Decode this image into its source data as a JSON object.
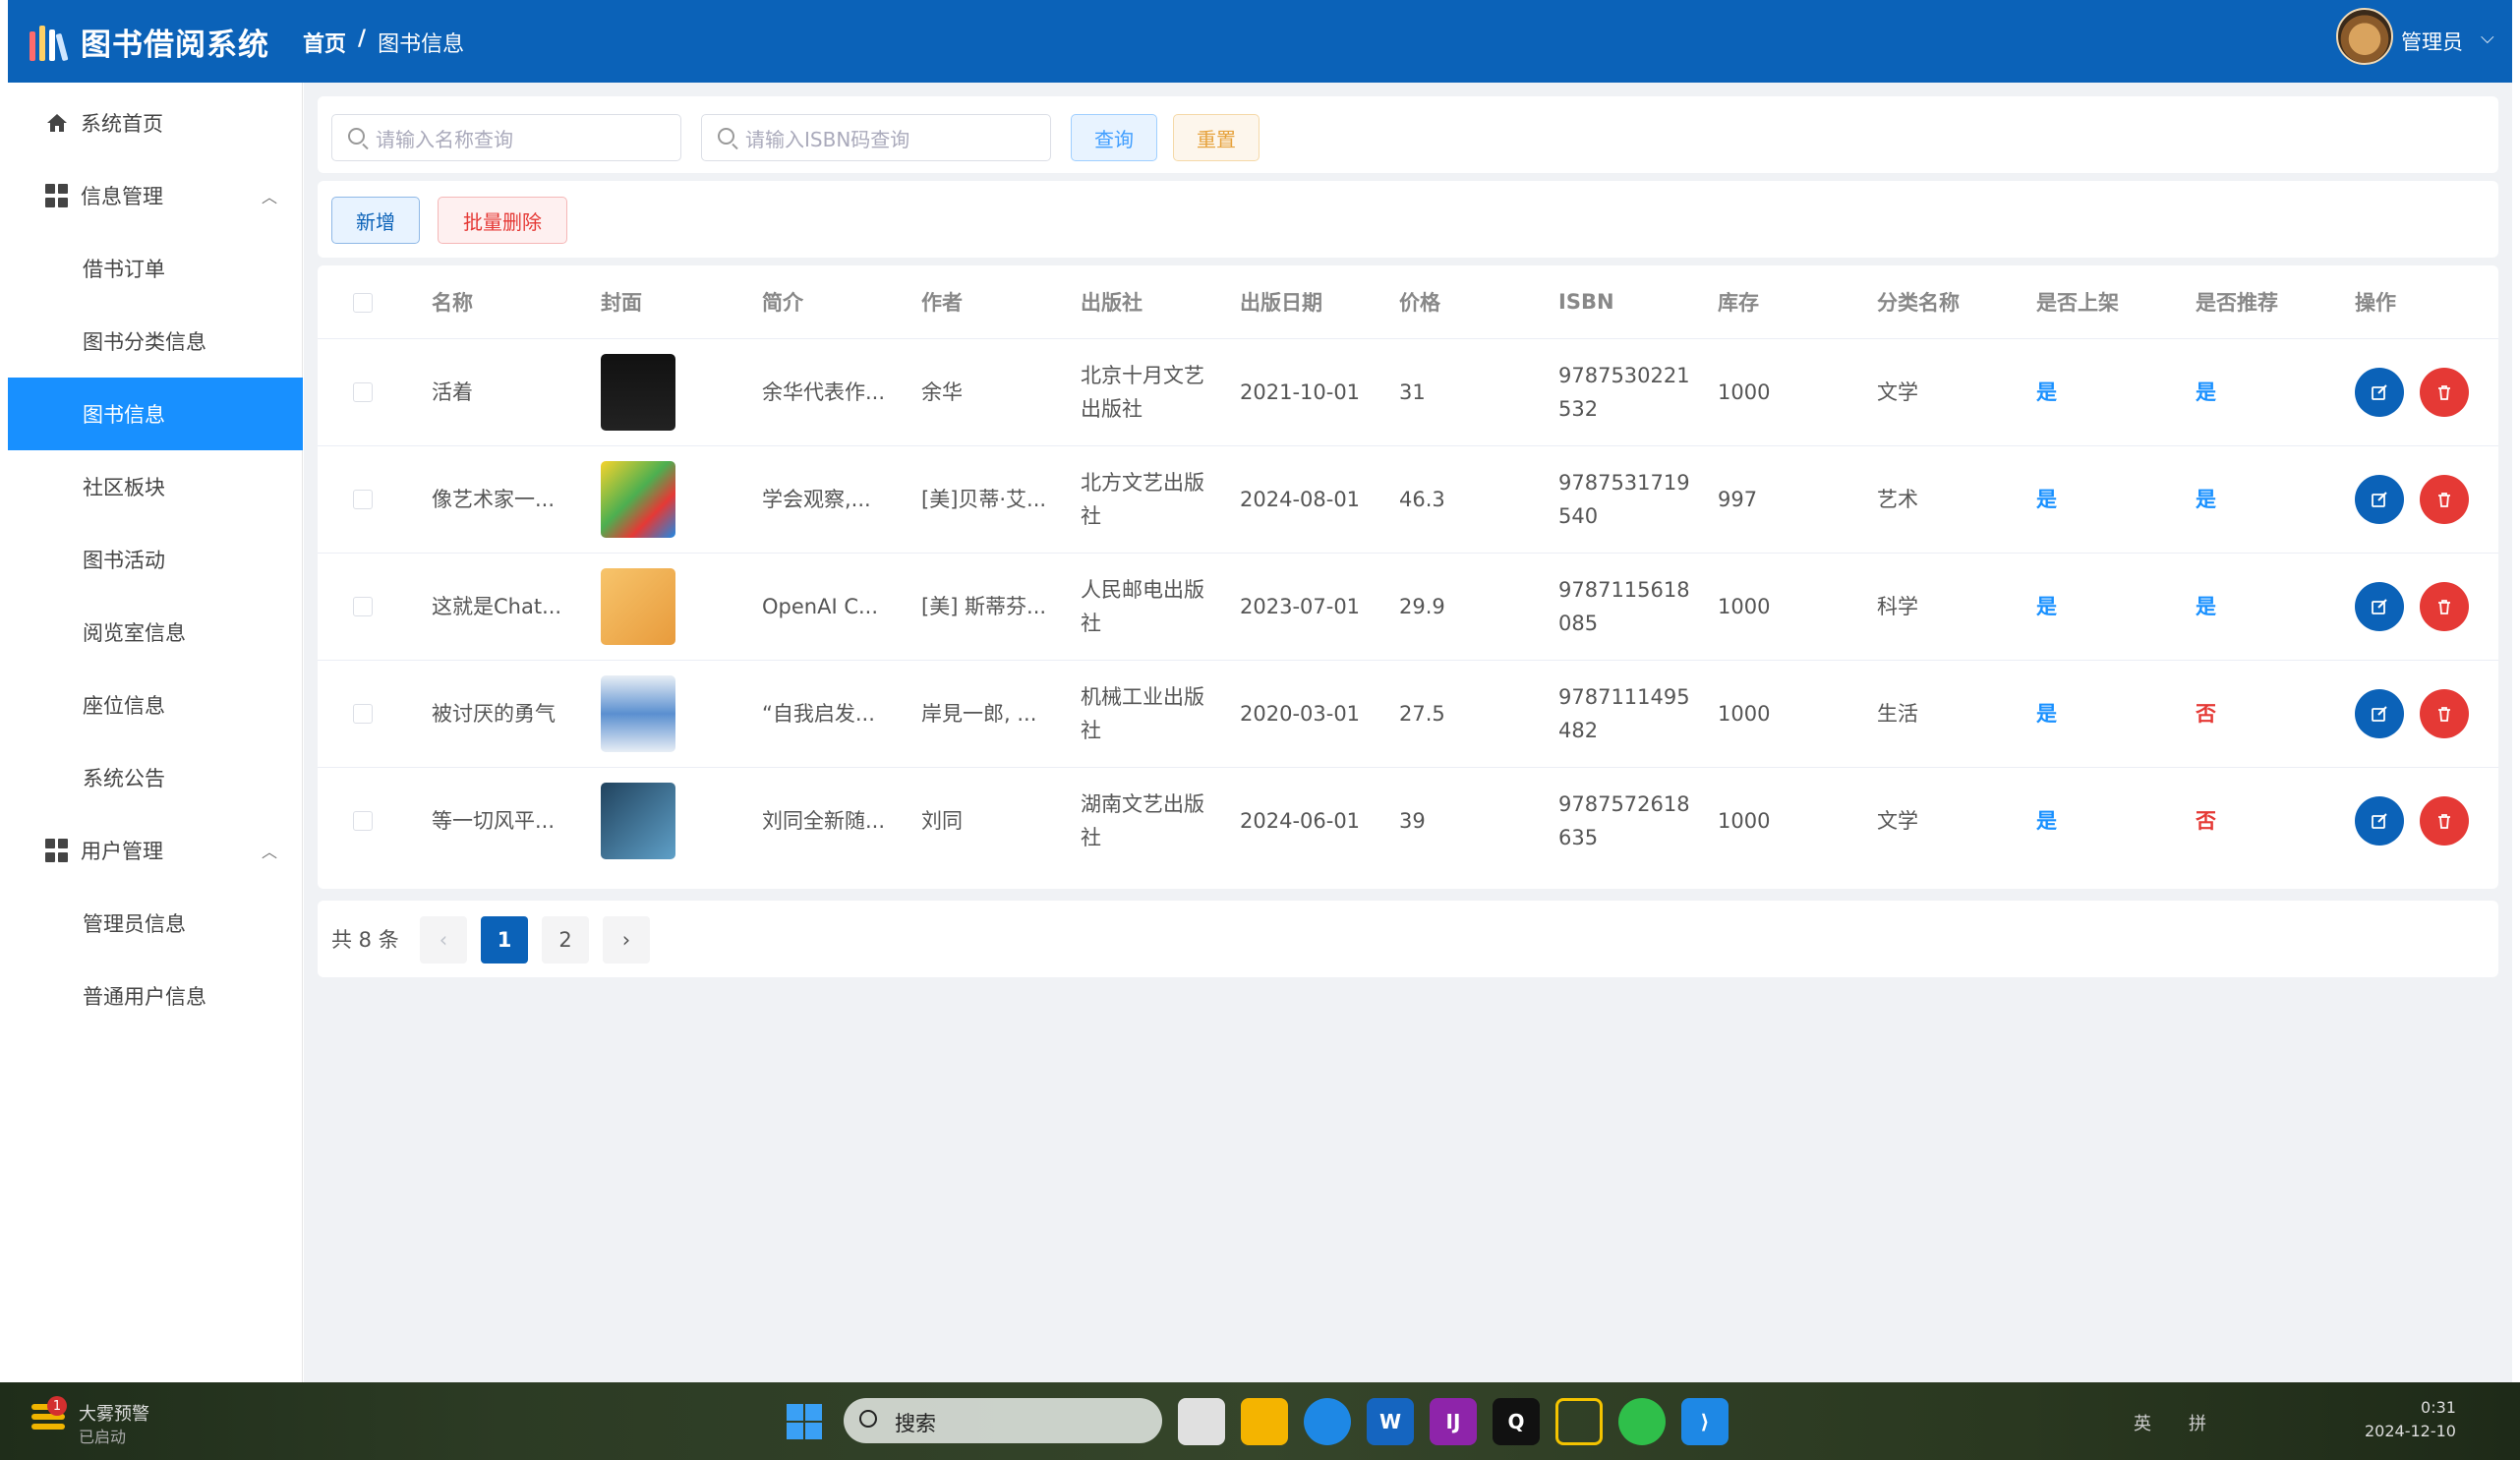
{
  "header": {
    "app_title": "图书借阅系统",
    "breadcrumb_home": "首页",
    "breadcrumb_sep": "/",
    "breadcrumb_current": "图书信息",
    "user_name": "管理员"
  },
  "sidebar": {
    "items": [
      {
        "label": "系统首页",
        "icon": "home-icon"
      },
      {
        "label": "信息管理",
        "icon": "grid-icon",
        "expanded": true
      },
      {
        "label": "借书订单"
      },
      {
        "label": "图书分类信息"
      },
      {
        "label": "图书信息",
        "active": true
      },
      {
        "label": "社区板块"
      },
      {
        "label": "图书活动"
      },
      {
        "label": "阅览室信息"
      },
      {
        "label": "座位信息"
      },
      {
        "label": "系统公告"
      },
      {
        "label": "用户管理",
        "icon": "grid-icon",
        "expanded": true
      },
      {
        "label": "管理员信息"
      },
      {
        "label": "普通用户信息"
      }
    ]
  },
  "search": {
    "name_placeholder": "请输入名称查询",
    "isbn_placeholder": "请输入ISBN码查询",
    "query_label": "查询",
    "reset_label": "重置"
  },
  "actions": {
    "add_label": "新增",
    "bulk_delete_label": "批量删除"
  },
  "table": {
    "columns": [
      "名称",
      "封面",
      "简介",
      "作者",
      "出版社",
      "出版日期",
      "价格",
      "ISBN",
      "库存",
      "分类名称",
      "是否上架",
      "是否推荐",
      "操作"
    ],
    "rows": [
      {
        "name": "活着",
        "cover": "black",
        "intro": "余华代表作...",
        "author": "余华",
        "publisher_l1": "北京十月文艺",
        "publisher_l2": "出版社",
        "date": "2021-10-01",
        "price": "31",
        "isbn_l1": "9787530221",
        "isbn_l2": "532",
        "stock": "1000",
        "category": "文学",
        "on_shelf": "是",
        "recommended": "是"
      },
      {
        "name": "像艺术家一...",
        "cover": "yellow",
        "intro": "学会观察,...",
        "author": "[美]贝蒂·艾...",
        "publisher_l1": "北方文艺出版",
        "publisher_l2": "社",
        "date": "2024-08-01",
        "price": "46.3",
        "isbn_l1": "9787531719",
        "isbn_l2": "540",
        "stock": "997",
        "category": "艺术",
        "on_shelf": "是",
        "recommended": "是"
      },
      {
        "name": "这就是Chat...",
        "cover": "orange",
        "intro": "OpenAI C...",
        "author": "[美] 斯蒂芬...",
        "publisher_l1": "人民邮电出版",
        "publisher_l2": "社",
        "date": "2023-07-01",
        "price": "29.9",
        "isbn_l1": "9787115618",
        "isbn_l2": "085",
        "stock": "1000",
        "category": "科学",
        "on_shelf": "是",
        "recommended": "是"
      },
      {
        "name": "被讨厌的勇气",
        "cover": "blue",
        "intro": "“自我启发...",
        "author": "岸見一郎, ...",
        "publisher_l1": "机械工业出版",
        "publisher_l2": "社",
        "date": "2020-03-01",
        "price": "27.5",
        "isbn_l1": "9787111495",
        "isbn_l2": "482",
        "stock": "1000",
        "category": "生活",
        "on_shelf": "是",
        "recommended": "否"
      },
      {
        "name": "等一切风平...",
        "cover": "teal",
        "intro": "刘同全新随...",
        "author": "刘同",
        "publisher_l1": "湖南文艺出版",
        "publisher_l2": "社",
        "date": "2024-06-01",
        "price": "39",
        "isbn_l1": "9787572618",
        "isbn_l2": "635",
        "stock": "1000",
        "category": "文学",
        "on_shelf": "是",
        "recommended": "否"
      }
    ]
  },
  "pagination": {
    "total_label": "共 8 条",
    "prev": "‹",
    "pages": [
      "1",
      "2"
    ],
    "current": "1",
    "next": "›"
  },
  "taskbar": {
    "weather_line1": "大雾预警",
    "weather_line2": "已启动",
    "badge": "1",
    "search_label": "搜索",
    "tray_lang1": "英",
    "tray_lang2": "拼",
    "clock_time": "0:31",
    "clock_date": "2024-12-10"
  },
  "colors": {
    "brand": "#0b62b8",
    "active_menu": "#1890ff",
    "yes": "#1890ff",
    "no": "#e53935"
  }
}
